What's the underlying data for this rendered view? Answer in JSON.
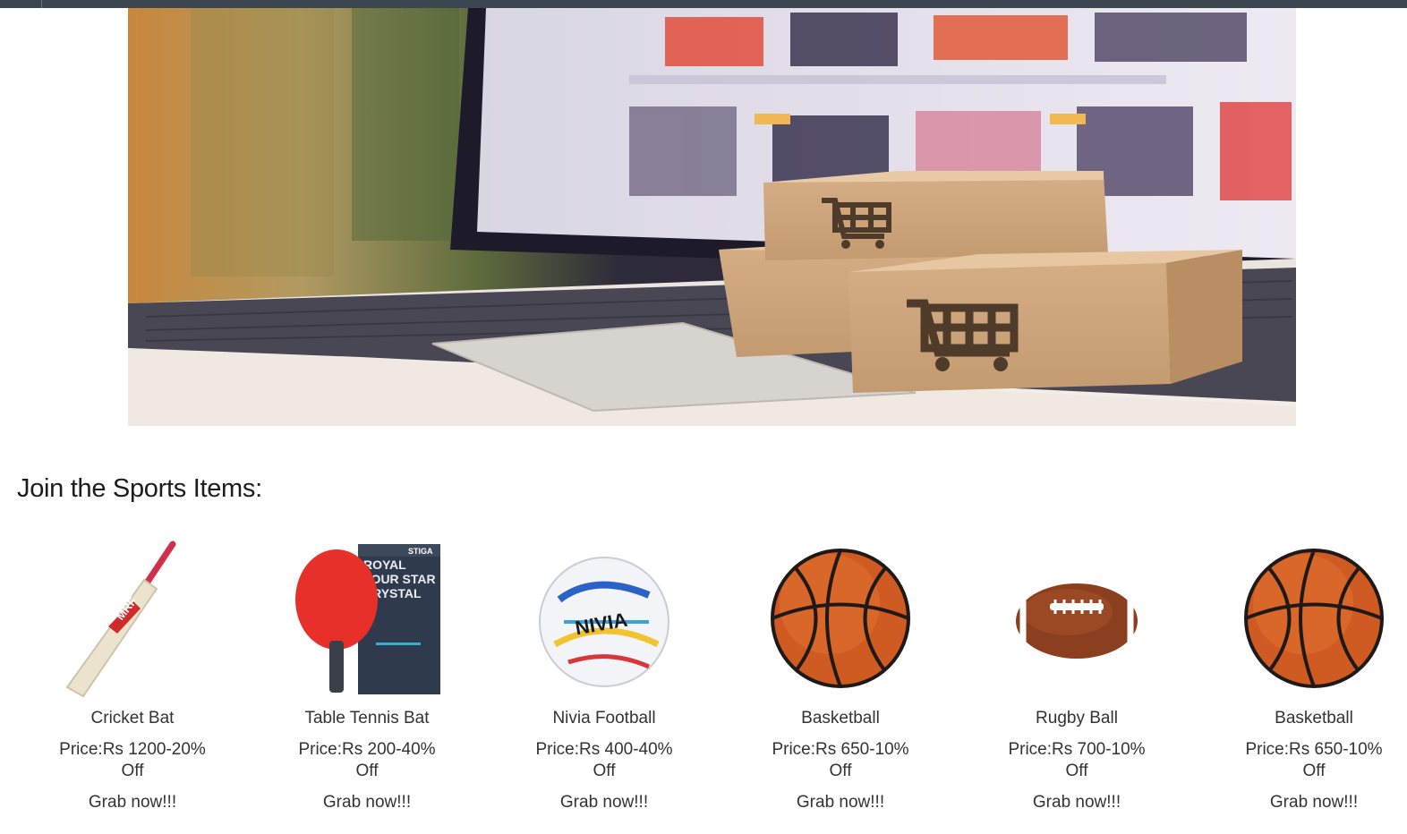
{
  "banner": {
    "image_alt": "laptop with shopping cart boxes"
  },
  "section": {
    "title": "Join the Sports Items:"
  },
  "products": [
    {
      "name": "Cricket Bat",
      "price": "Price:Rs 1200-20% Off",
      "cta": "Grab now!!!",
      "icon": "cricket-bat-icon"
    },
    {
      "name": "Table Tennis Bat",
      "price": "Price:Rs 200-40% Off",
      "cta": "Grab now!!!",
      "icon": "table-tennis-bat-icon"
    },
    {
      "name": "Nivia Football",
      "price": "Price:Rs 400-40% Off",
      "cta": "Grab now!!!",
      "icon": "football-icon"
    },
    {
      "name": "Basketball",
      "price": "Price:Rs 650-10% Off",
      "cta": "Grab now!!!",
      "icon": "basketball-icon"
    },
    {
      "name": "Rugby Ball",
      "price": "Price:Rs 700-10% Off",
      "cta": "Grab now!!!",
      "icon": "rugby-ball-icon"
    },
    {
      "name": "Basketball",
      "price": "Price:Rs 650-10% Off",
      "cta": "Grab now!!!",
      "icon": "basketball-icon"
    }
  ],
  "brand_marks": {
    "bat": "MRF",
    "tt_box": "ROYAL FOUR STAR CRYSTAL",
    "tt_brand": "STIGA",
    "football": "NIVIA"
  }
}
